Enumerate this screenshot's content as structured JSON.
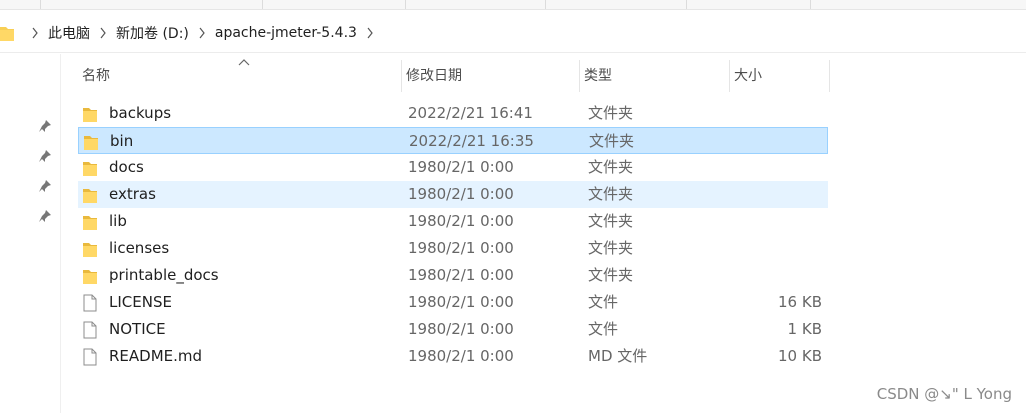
{
  "breadcrumb": [
    {
      "label": "此电脑"
    },
    {
      "label": "新加卷 (D:)"
    },
    {
      "label": "apache-jmeter-5.4.3"
    }
  ],
  "columns": {
    "name": "名称",
    "date": "修改日期",
    "type": "类型",
    "size": "大小"
  },
  "files": [
    {
      "name": "backups",
      "date": "2022/2/21 16:41",
      "type": "文件夹",
      "size": "",
      "kind": "folder"
    },
    {
      "name": "bin",
      "date": "2022/2/21 16:35",
      "type": "文件夹",
      "size": "",
      "kind": "folder"
    },
    {
      "name": "docs",
      "date": "1980/2/1 0:00",
      "type": "文件夹",
      "size": "",
      "kind": "folder"
    },
    {
      "name": "extras",
      "date": "1980/2/1 0:00",
      "type": "文件夹",
      "size": "",
      "kind": "folder"
    },
    {
      "name": "lib",
      "date": "1980/2/1 0:00",
      "type": "文件夹",
      "size": "",
      "kind": "folder"
    },
    {
      "name": "licenses",
      "date": "1980/2/1 0:00",
      "type": "文件夹",
      "size": "",
      "kind": "folder"
    },
    {
      "name": "printable_docs",
      "date": "1980/2/1 0:00",
      "type": "文件夹",
      "size": "",
      "kind": "folder"
    },
    {
      "name": "LICENSE",
      "date": "1980/2/1 0:00",
      "type": "文件",
      "size": "16 KB",
      "kind": "file"
    },
    {
      "name": "NOTICE",
      "date": "1980/2/1 0:00",
      "type": "文件",
      "size": "1 KB",
      "kind": "file"
    },
    {
      "name": "README.md",
      "date": "1980/2/1 0:00",
      "type": "MD 文件",
      "size": "10 KB",
      "kind": "file"
    }
  ],
  "selected_index": 1,
  "hover_index": 3,
  "watermark": "CSDN @↘\" L Yong",
  "colors": {
    "selected_bg": "#cce8ff",
    "selected_border": "#99d1ff",
    "hover_bg": "#e5f3ff",
    "folder": "#f8cf55"
  },
  "icons": {
    "folder": "folder-icon",
    "file": "file-icon",
    "pin": "pin-icon",
    "chevron": "chevron-right-icon",
    "sort": "sort-ascending-icon"
  }
}
